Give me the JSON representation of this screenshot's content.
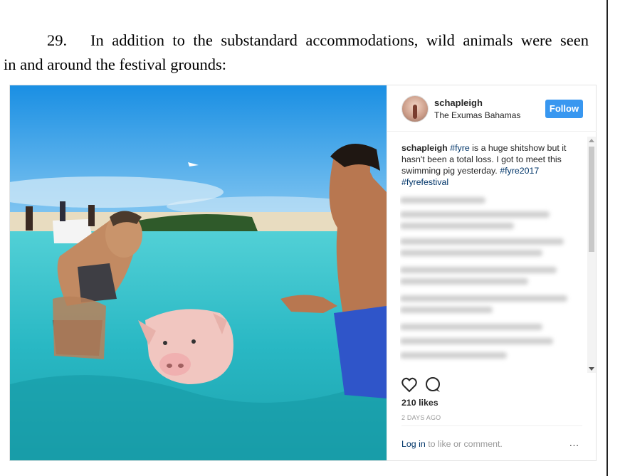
{
  "document": {
    "paragraph_number": "29.",
    "line1": "In addition to the substandard accommodations, wild animals were seen",
    "line2": "in and around the festival grounds:"
  },
  "post": {
    "username": "schapleigh",
    "location": "The Exumas Bahamas",
    "follow_label": "Follow",
    "caption_user": "schapleigh",
    "caption_tag1": "#fyre",
    "caption_text": " is a huge shitshow but it hasn't been a total loss. I got to meet this swimming pig yesterday. ",
    "caption_tag2": "#fyre2017",
    "caption_tag3": "#fyrefestival",
    "likes": "210 likes",
    "time_ago": "2 DAYS AGO",
    "login_link": "Log in",
    "login_rest": " to like or comment.",
    "more_label": "..."
  },
  "icons": [
    "heart-icon",
    "comment-icon",
    "more-options-icon",
    "avatar",
    "scroll-up-arrow-icon",
    "scroll-down-arrow-icon"
  ],
  "colors": {
    "follow": "#3897f0",
    "link": "#003569",
    "muted": "#999999"
  }
}
